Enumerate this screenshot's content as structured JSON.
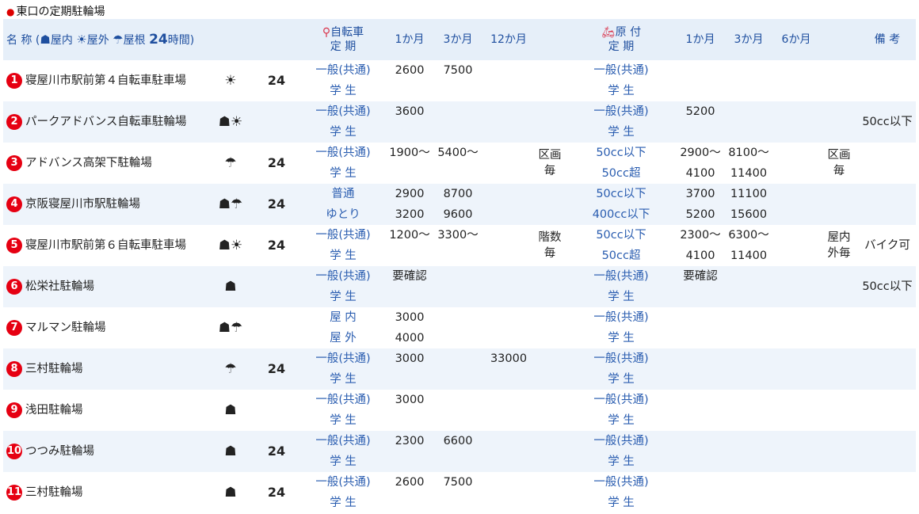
{
  "title": "東口の定期駐輪場",
  "header": {
    "name_label": "名 称",
    "indoor_label": "屋内",
    "outdoor_label": "屋外",
    "roof_label": "屋根",
    "h24_num": "24",
    "h24_label": "時間)",
    "bike_line1": "自転車",
    "bike_line2": "定 期",
    "m1": "1か月",
    "m3": "3か月",
    "m12": "12か月",
    "moped_line1": "原 付",
    "moped_line2": "定 期",
    "mm1": "1か月",
    "mm3": "3か月",
    "mm6": "6か月",
    "notes": "備 考"
  },
  "rows": [
    {
      "no": "1",
      "name": "寝屋川市駅前第４自転車駐車場",
      "icons": "☀",
      "h24": "24",
      "b": [
        [
          "一般(共通)",
          "2600",
          "7500",
          ""
        ],
        [
          "学 生",
          "",
          "",
          ""
        ]
      ],
      "bnote": "",
      "m": [
        [
          "一般(共通)",
          "",
          "",
          ""
        ],
        [
          "学 生",
          "",
          "",
          ""
        ]
      ],
      "mnote": "",
      "note": ""
    },
    {
      "no": "2",
      "name": "パークアドバンス自転車駐輪場",
      "icons": "☗☀",
      "h24": "",
      "b": [
        [
          "一般(共通)",
          "3600",
          "",
          ""
        ],
        [
          "学 生",
          "",
          "",
          ""
        ]
      ],
      "bnote": "",
      "m": [
        [
          "一般(共通)",
          "5200",
          "",
          ""
        ],
        [
          "学 生",
          "",
          "",
          ""
        ]
      ],
      "mnote": "",
      "note": "50cc以下"
    },
    {
      "no": "3",
      "name": "アドバンス高架下駐輪場",
      "icons": "☂",
      "h24": "24",
      "b": [
        [
          "一般(共通)",
          "1900～",
          "5400～",
          ""
        ],
        [
          "学 生",
          "",
          "",
          ""
        ]
      ],
      "bnote": "区画\n毎",
      "m": [
        [
          "50cc以下",
          "2900～",
          "8100～",
          ""
        ],
        [
          "50cc超",
          "4100",
          "11400",
          ""
        ]
      ],
      "mnote": "区画\n毎",
      "note": ""
    },
    {
      "no": "4",
      "name": "京阪寝屋川市駅駐輪場",
      "icons": "☗☂",
      "h24": "24",
      "b": [
        [
          "普通",
          "2900",
          "8700",
          ""
        ],
        [
          "ゆとり",
          "3200",
          "9600",
          ""
        ]
      ],
      "bnote": "",
      "m": [
        [
          "50cc以下",
          "3700",
          "11100",
          ""
        ],
        [
          "400cc以下",
          "5200",
          "15600",
          ""
        ]
      ],
      "mnote": "",
      "note": ""
    },
    {
      "no": "5",
      "name": "寝屋川市駅前第６自転車駐車場",
      "icons": "☗☀",
      "h24": "24",
      "b": [
        [
          "一般(共通)",
          "1200～",
          "3300～",
          ""
        ],
        [
          "学 生",
          "",
          "",
          ""
        ]
      ],
      "bnote": "階数\n毎",
      "m": [
        [
          "50cc以下",
          "2300～",
          "6300～",
          ""
        ],
        [
          "50cc超",
          "4100",
          "11400",
          ""
        ]
      ],
      "mnote": "屋内\n外毎",
      "note": "バイク可"
    },
    {
      "no": "6",
      "name": "松栄社駐輪場",
      "icons": "☗",
      "h24": "",
      "b": [
        [
          "一般(共通)",
          "要確認",
          "",
          ""
        ],
        [
          "学 生",
          "",
          "",
          ""
        ]
      ],
      "bnote": "",
      "m": [
        [
          "一般(共通)",
          "要確認",
          "",
          ""
        ],
        [
          "学 生",
          "",
          "",
          ""
        ]
      ],
      "mnote": "",
      "note": "50cc以下"
    },
    {
      "no": "7",
      "name": "マルマン駐輪場",
      "icons": "☗☂",
      "h24": "",
      "b": [
        [
          "屋 内",
          "3000",
          "",
          ""
        ],
        [
          "屋 外",
          "4000",
          "",
          ""
        ]
      ],
      "bnote": "",
      "m": [
        [
          "一般(共通)",
          "",
          "",
          ""
        ],
        [
          "学 生",
          "",
          "",
          ""
        ]
      ],
      "mnote": "",
      "note": ""
    },
    {
      "no": "8",
      "name": "三村駐輪場",
      "icons": "☂",
      "h24": "24",
      "b": [
        [
          "一般(共通)",
          "3000",
          "",
          "33000"
        ],
        [
          "学 生",
          "",
          "",
          ""
        ]
      ],
      "bnote": "",
      "m": [
        [
          "一般(共通)",
          "",
          "",
          ""
        ],
        [
          "学 生",
          "",
          "",
          ""
        ]
      ],
      "mnote": "",
      "note": ""
    },
    {
      "no": "9",
      "name": "浅田駐輪場",
      "icons": "☗",
      "h24": "",
      "b": [
        [
          "一般(共通)",
          "3000",
          "",
          ""
        ],
        [
          "学 生",
          "",
          "",
          ""
        ]
      ],
      "bnote": "",
      "m": [
        [
          "一般(共通)",
          "",
          "",
          ""
        ],
        [
          "学 生",
          "",
          "",
          ""
        ]
      ],
      "mnote": "",
      "note": ""
    },
    {
      "no": "10",
      "name": "つつみ駐輪場",
      "icons": "☗",
      "h24": "24",
      "b": [
        [
          "一般(共通)",
          "2300",
          "6600",
          ""
        ],
        [
          "学 生",
          "",
          "",
          ""
        ]
      ],
      "bnote": "",
      "m": [
        [
          "一般(共通)",
          "",
          "",
          ""
        ],
        [
          "学 生",
          "",
          "",
          ""
        ]
      ],
      "mnote": "",
      "note": ""
    },
    {
      "no": "11",
      "name": "三村駐輪場",
      "icons": "☗",
      "h24": "24",
      "b": [
        [
          "一般(共通)",
          "2600",
          "7500",
          ""
        ],
        [
          "学 生",
          "",
          "",
          ""
        ]
      ],
      "bnote": "",
      "m": [
        [
          "一般(共通)",
          "",
          "",
          ""
        ],
        [
          "学 生",
          "",
          "",
          ""
        ]
      ],
      "mnote": "",
      "note": ""
    }
  ]
}
